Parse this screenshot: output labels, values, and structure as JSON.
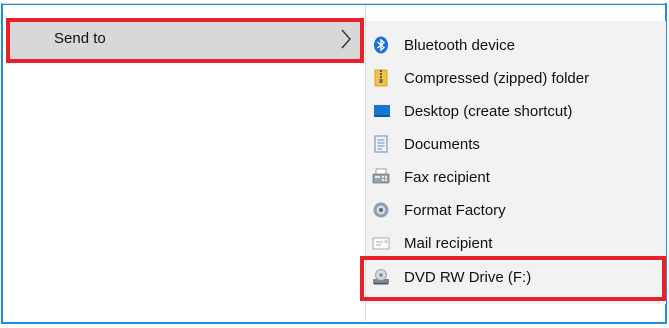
{
  "menu": {
    "send_to_label": "Send to",
    "submenu_items": [
      {
        "label": "Bluetooth device",
        "icon": "bluetooth-icon"
      },
      {
        "label": "Compressed (zipped) folder",
        "icon": "zip-folder-icon"
      },
      {
        "label": "Desktop (create shortcut)",
        "icon": "desktop-icon"
      },
      {
        "label": "Documents",
        "icon": "documents-icon"
      },
      {
        "label": "Fax recipient",
        "icon": "fax-icon"
      },
      {
        "label": "Format Factory",
        "icon": "format-factory-icon"
      },
      {
        "label": "Mail recipient",
        "icon": "mail-icon"
      },
      {
        "label": "DVD RW Drive (F:)",
        "icon": "dvd-drive-icon"
      }
    ]
  },
  "colors": {
    "highlight": "#e8202a",
    "frame": "#1e8fe0",
    "hover": "#d8d8d8",
    "submenu_bg": "#f2f2f2"
  }
}
